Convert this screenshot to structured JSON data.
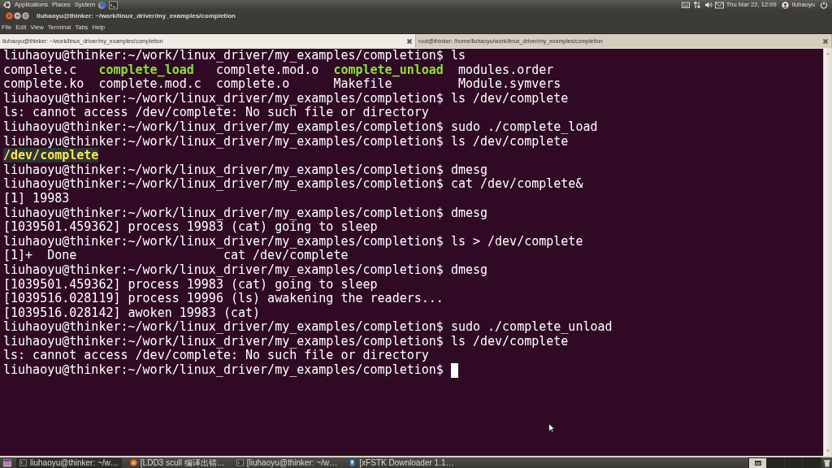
{
  "top_panel": {
    "menus": [
      "Applications",
      "Places",
      "System"
    ],
    "clock": "Thu Mar 22, 12:09",
    "user": "liuhaoyu"
  },
  "window": {
    "title": "liuhaoyu@thinker: ~/work/linux_driver/my_examples/completion",
    "menu": [
      "File",
      "Edit",
      "View",
      "Terminal",
      "Tabs",
      "Help"
    ]
  },
  "tabs": [
    {
      "label": "liuhaoyu@thinker: ~/work/linux_driver/my_examples/completion",
      "selected": true
    },
    {
      "label": "root@thinker: /home/liuhaoyu/work/linux_driver/my_examples/completion",
      "selected": false
    }
  ],
  "terminal": {
    "cursor": true,
    "lines": [
      {
        "segments": [
          {
            "kind": "plain",
            "text": "liuhaoyu@thinker:~/work/linux_driver/my_examples/completion$ ls"
          }
        ]
      },
      {
        "segments": [
          {
            "kind": "plain",
            "text": "complete.c   "
          },
          {
            "kind": "executable",
            "text": "complete_load"
          },
          {
            "kind": "plain",
            "text": "   complete.mod.o  "
          },
          {
            "kind": "executable",
            "text": "complete_unload"
          },
          {
            "kind": "plain",
            "text": "  modules.order"
          }
        ]
      },
      {
        "segments": [
          {
            "kind": "plain",
            "text": "complete.ko  complete.mod.c  complete.o      Makefile         Module.symvers"
          }
        ]
      },
      {
        "segments": [
          {
            "kind": "plain",
            "text": "liuhaoyu@thinker:~/work/linux_driver/my_examples/completion$ ls /dev/complete"
          }
        ]
      },
      {
        "segments": [
          {
            "kind": "plain",
            "text": "ls: cannot access /dev/complete: No such file or directory"
          }
        ]
      },
      {
        "segments": [
          {
            "kind": "plain",
            "text": "liuhaoyu@thinker:~/work/linux_driver/my_examples/completion$ sudo ./complete_load"
          }
        ]
      },
      {
        "segments": [
          {
            "kind": "plain",
            "text": "liuhaoyu@thinker:~/work/linux_driver/my_examples/completion$ ls /dev/complete"
          }
        ]
      },
      {
        "segments": [
          {
            "kind": "device",
            "text": "/dev/complete"
          }
        ]
      },
      {
        "segments": [
          {
            "kind": "plain",
            "text": "liuhaoyu@thinker:~/work/linux_driver/my_examples/completion$ dmesg"
          }
        ]
      },
      {
        "segments": [
          {
            "kind": "plain",
            "text": "liuhaoyu@thinker:~/work/linux_driver/my_examples/completion$ cat /dev/complete&"
          }
        ]
      },
      {
        "segments": [
          {
            "kind": "plain",
            "text": "[1] 19983"
          }
        ]
      },
      {
        "segments": [
          {
            "kind": "plain",
            "text": "liuhaoyu@thinker:~/work/linux_driver/my_examples/completion$ dmesg"
          }
        ]
      },
      {
        "segments": [
          {
            "kind": "plain",
            "text": "[1039501.459362] process 19983 (cat) going to sleep"
          }
        ]
      },
      {
        "segments": [
          {
            "kind": "plain",
            "text": "liuhaoyu@thinker:~/work/linux_driver/my_examples/completion$ ls > /dev/complete"
          }
        ]
      },
      {
        "segments": [
          {
            "kind": "plain",
            "text": "[1]+  Done                    cat /dev/complete"
          }
        ]
      },
      {
        "segments": [
          {
            "kind": "plain",
            "text": "liuhaoyu@thinker:~/work/linux_driver/my_examples/completion$ dmesg"
          }
        ]
      },
      {
        "segments": [
          {
            "kind": "plain",
            "text": "[1039501.459362] process 19983 (cat) going to sleep"
          }
        ]
      },
      {
        "segments": [
          {
            "kind": "plain",
            "text": "[1039516.028119] process 19996 (ls) awakening the readers..."
          }
        ]
      },
      {
        "segments": [
          {
            "kind": "plain",
            "text": "[1039516.028142] awoken 19983 (cat)"
          }
        ]
      },
      {
        "segments": [
          {
            "kind": "plain",
            "text": "liuhaoyu@thinker:~/work/linux_driver/my_examples/completion$ sudo ./complete_unload"
          }
        ]
      },
      {
        "segments": [
          {
            "kind": "plain",
            "text": "liuhaoyu@thinker:~/work/linux_driver/my_examples/completion$ ls /dev/complete"
          }
        ]
      },
      {
        "segments": [
          {
            "kind": "plain",
            "text": "ls: cannot access /dev/complete: No such file or directory"
          }
        ]
      },
      {
        "segments": [
          {
            "kind": "plain",
            "text": "liuhaoyu@thinker:~/work/linux_driver/my_examples/completion$"
          }
        ]
      }
    ]
  },
  "taskbar": {
    "items": [
      {
        "kind": "terminal",
        "label": "liuhaoyu@thinker: ~/w…",
        "selected": true
      },
      {
        "kind": "browser",
        "label": "[LDD3 scull 编译出错…",
        "selected": false
      },
      {
        "kind": "terminal",
        "label": "[liuhaoyu@thinker: ~/w…",
        "selected": false
      },
      {
        "kind": "app",
        "label": "[xFSTK Downloader 1.1…",
        "selected": false
      }
    ],
    "workspaces": [
      {
        "selected": true
      },
      {
        "selected": false
      },
      {
        "selected": false
      },
      {
        "selected": false
      }
    ]
  }
}
